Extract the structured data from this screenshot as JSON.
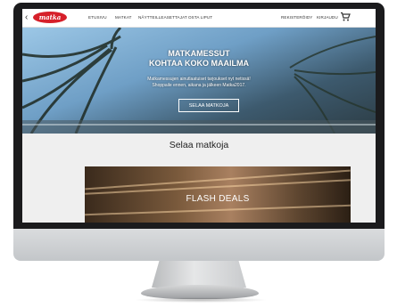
{
  "nav": {
    "logo": "matka",
    "links": [
      "ETUSIVU",
      "MATKAT",
      "NÄYTTEILLEASETTAJAT",
      "OSTA LIPUT"
    ],
    "register": "REKISTERÖIDY",
    "login": "KIRJAUDU"
  },
  "hero": {
    "title_line1": "MATKAMESSUT",
    "title_line2": "KOHTAA KOKO MAAILMA",
    "subtitle_line1": "Matkamessujen ainutlaatuiset tarjoukset nyt netissä!",
    "subtitle_line2": "Shoppaile ennen, aikana ja jälkeen Matka2017.",
    "button": "SELAA MATKOJA"
  },
  "section": {
    "title": "Selaa matkoja"
  },
  "flash": {
    "label": "FLASH DEALS"
  },
  "colors": {
    "brand": "#d6202a"
  }
}
